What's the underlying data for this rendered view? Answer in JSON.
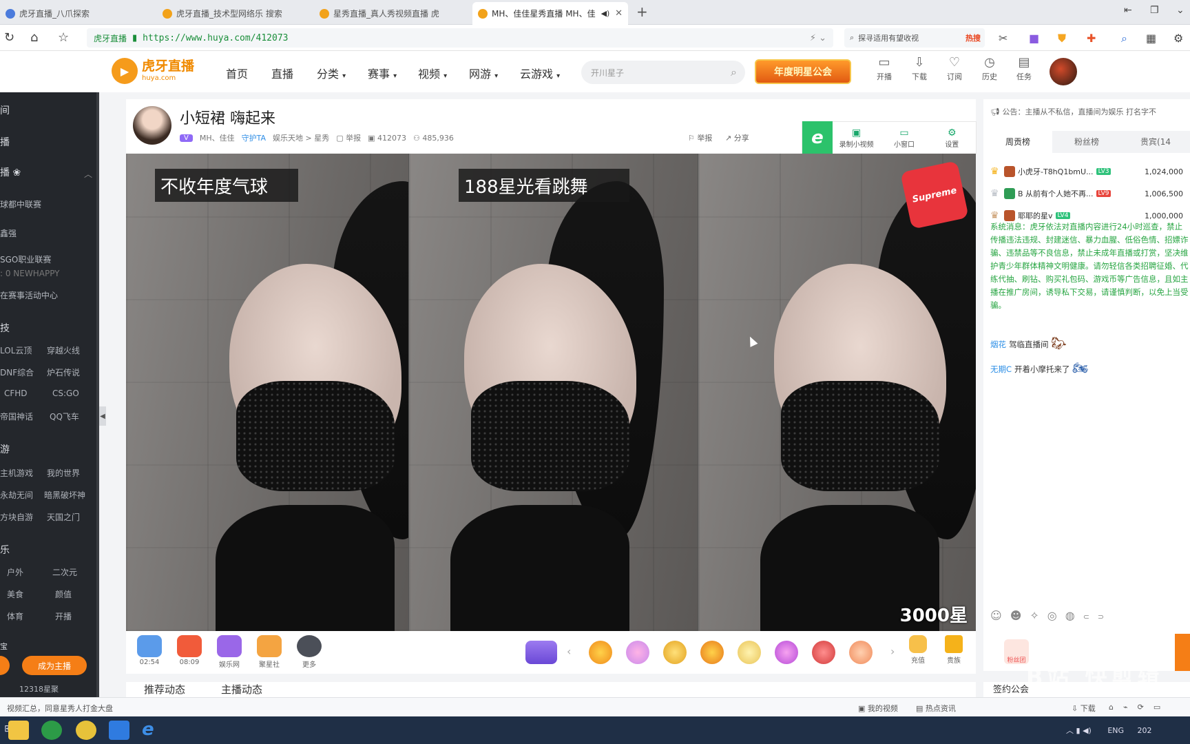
{
  "tabs": [
    {
      "label": "虎牙直播_八爪探索"
    },
    {
      "label": "虎牙直播_技术型网络乐 搜索"
    },
    {
      "label": "星秀直播_真人秀视频直播 虎"
    },
    {
      "label": "MH、佳佳星秀直播 MH、佳"
    }
  ],
  "address": {
    "site_label": "虎牙直播",
    "url": "https://www.huya.com/412073"
  },
  "browser_search": {
    "placeholder": "探寻适用有望收视",
    "hot": "热搜"
  },
  "site": {
    "logo_main": "虎牙直播",
    "logo_sub": "huya.com",
    "nav": [
      "首页",
      "直播",
      "分类",
      "赛事",
      "视频",
      "网游",
      "云游戏"
    ],
    "search_placeholder": "开川星子",
    "star_badge": "年度明星公会",
    "header_icons": [
      "开播",
      "下载",
      "订阅",
      "历史",
      "任务"
    ]
  },
  "sidebar": {
    "sections": [
      {
        "label": "间"
      },
      {
        "label": "播"
      },
      {
        "label": "播 ❀"
      }
    ],
    "items": [
      "球都中联赛",
      "鑫强",
      "SGO职业联赛",
      ": 0 NEWHAPPY",
      "在赛事活动中心"
    ],
    "section_games": "技",
    "game_grid": [
      [
        "LOL云顶",
        "穿越火线"
      ],
      [
        "DNF综合",
        "炉石传说"
      ],
      [
        "CFHD",
        "CS:GO"
      ],
      [
        "帝国神话",
        "QQ飞车"
      ]
    ],
    "section_mobile": "游",
    "mobile_grid": [
      [
        "主机游戏",
        "我的世界"
      ],
      [
        "永劫无间",
        "暗黑破坏神"
      ],
      [
        "方块自游",
        "天国之门"
      ]
    ],
    "section_ent": "乐",
    "ent_grid": [
      [
        "户外",
        "二次元"
      ],
      [
        "美食",
        "颜值"
      ],
      [
        "体育",
        "开播"
      ]
    ],
    "section_last": "宝",
    "become_host": "成为主播",
    "fans_count": "12318星聚"
  },
  "room": {
    "title": "小短裙 嗨起来",
    "host": "MH、佳佳",
    "tag": "守护TA",
    "category": "娱乐天地 > 星秀",
    "report": "举报",
    "room_id": "412073",
    "viewers": "485,936",
    "share": "分享",
    "tools": [
      "录制小视频",
      "小窗口",
      "设置"
    ]
  },
  "video": {
    "captions": [
      "不收年度气球",
      "188星光看跳舞"
    ],
    "bottom_caption": "3000星",
    "gift_box_label": "Supreme"
  },
  "giftbar": {
    "left_items": [
      {
        "label": "02:54",
        "color": "#5b9bea"
      },
      {
        "label": "08:09",
        "color": "#f15b3a"
      },
      {
        "label": "娱乐网",
        "color": "#9a67e8"
      },
      {
        "label": "聚星社",
        "color": "#f4a441"
      },
      {
        "label": "更多",
        "color": "#4b4f58"
      }
    ],
    "right_items": [
      "充值",
      "贵族"
    ]
  },
  "below_tabs": [
    "推荐动态",
    "主播动态"
  ],
  "rightpanel": {
    "notice": "公告：主播从不私信，直播间为娱乐 打名字不",
    "tabs": [
      "周贡榜",
      "粉丝榜",
      "贵宾(14"
    ],
    "ranks": [
      {
        "name": "小虎牙-T8hQ1bmU...",
        "level": "LV3",
        "score": "1,024,000"
      },
      {
        "name": "B 从前有个人她不再...",
        "level": "LV9",
        "score": "1,006,500"
      },
      {
        "name": "耶耶的星v",
        "level": "LV4",
        "score": "1,000,000"
      }
    ],
    "system_message": "系统消息：虎牙依法对直播内容进行24小时巡查，禁止传播违法违规、封建迷信、暴力血腥、低俗色情、招嫖诈骗、违禁品等不良信息，禁止未成年直播或打赏，坚决维护青少年群体精神文明健康。请勿轻信各类招聘征婚、代练代抽、刷钻、购买礼包码、游戏币等广告信息，且如主播在推广房间，诱导私下交易，请谨慎判断，以免上当受骗。",
    "chats": [
      {
        "nick": "烟花",
        "text": "驾临直播间"
      },
      {
        "nick": "无期C",
        "text": "开着小摩托来了"
      }
    ],
    "fans_label": "粉丝团",
    "footer": "签约公会"
  },
  "statusbar": {
    "left": "视频汇总，同意星秀人打金大盘",
    "items": [
      "我的视频",
      "热点资讯",
      "下载"
    ]
  },
  "taskbar": {
    "tray": "ENG",
    "clock": "202"
  },
  "watermark": "B站 快剪辑"
}
